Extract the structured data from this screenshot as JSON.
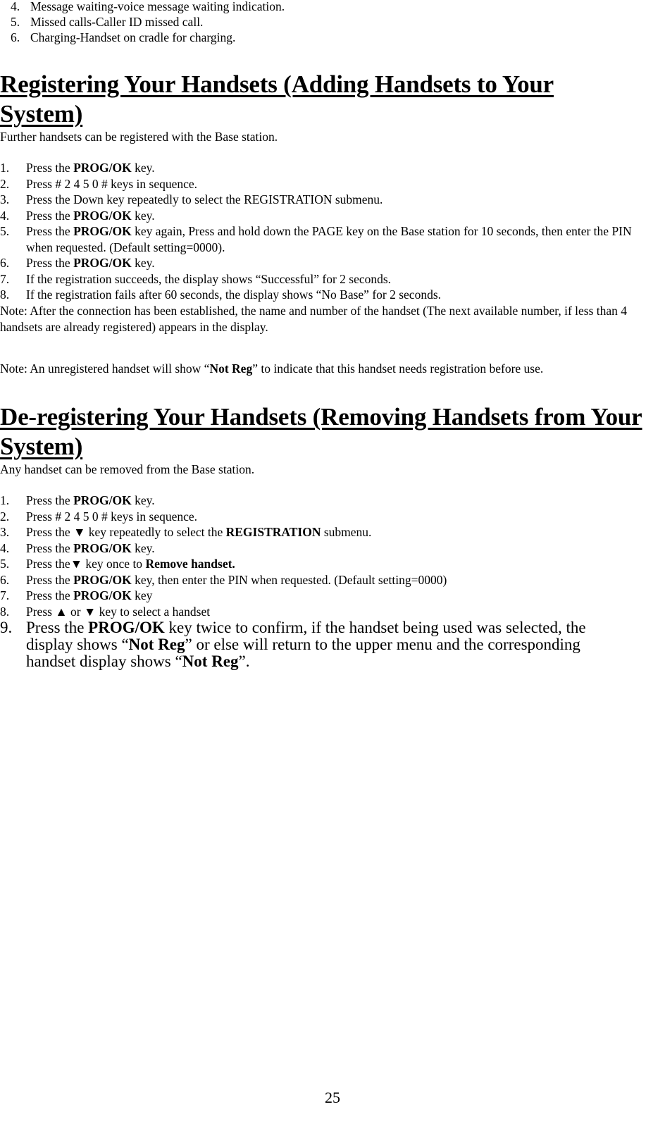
{
  "top_list": [
    {
      "num": "4.",
      "text": "Message waiting-voice message waiting indication."
    },
    {
      "num": "5.",
      "text": "Missed calls-Caller ID missed call."
    },
    {
      "num": "6.",
      "text": "Charging-Handset on cradle for charging."
    }
  ],
  "register": {
    "heading": "Registering Your Handsets (Adding Handsets to Your System)",
    "intro": "Further handsets can be registered with the Base station.",
    "steps": [
      {
        "num": "1.",
        "a": "Press the ",
        "b": "PROG/OK",
        "c": " key."
      },
      {
        "num": "2.",
        "a": "Press # 2 4 5 0 # keys in sequence.",
        "b": "",
        "c": ""
      },
      {
        "num": "3.",
        "a": "Press the Down key repeatedly to select the REGISTRATION submenu.",
        "b": "",
        "c": ""
      },
      {
        "num": "4.",
        "a": "Press the ",
        "b": "PROG/OK",
        "c": " key."
      },
      {
        "num": "5.",
        "a": "Press the ",
        "b": "PROG/OK",
        "c": " key again, Press and hold down the PAGE key on the Base station for 10 seconds, then enter the PIN when requested. (Default setting=0000)."
      },
      {
        "num": "6.",
        "a": "Press the ",
        "b": "PROG/OK",
        "c": " key."
      },
      {
        "num": "7.",
        "a": "If the registration succeeds, the display shows “Successful” for 2 seconds.",
        "b": "",
        "c": ""
      },
      {
        "num": "8.",
        "a": "If the registration fails after 60 seconds, the display shows “No Base” for 2 seconds.",
        "b": "",
        "c": ""
      }
    ],
    "note1": "Note: After the connection has been established, the name and number of the handset (The next available number, if less than 4 handsets are already registered) appears in the display.",
    "note2": {
      "a": "Note: An unregistered handset will show “",
      "b": "Not Reg",
      "c": "” to indicate that this handset needs registration before use."
    }
  },
  "deregister": {
    "heading": "De-registering Your Handsets (Removing Handsets from Your System)",
    "intro": "Any handset can be removed from the Base station.",
    "steps": [
      {
        "num": "1.",
        "a": "Press the ",
        "b": "PROG/OK",
        "c": " key.",
        "d": "",
        "e": ""
      },
      {
        "num": "2.",
        "a": "Press # 2 4 5 0 # keys in sequence.",
        "b": "",
        "c": "",
        "d": "",
        "e": ""
      },
      {
        "num": "3.",
        "a": " Press the ▼ key repeatedly to select the ",
        "b": "REGISTRATION",
        "c": " submenu.",
        "d": "",
        "e": ""
      },
      {
        "num": "4.",
        "a": "Press the ",
        "b": "PROG/OK",
        "c": " key.",
        "d": "",
        "e": ""
      },
      {
        "num": "5.",
        "a": "Press the▼ key once to ",
        "b": "Remove handset.",
        "c": "",
        "d": "",
        "e": ""
      },
      {
        "num": "6.",
        "a": "Press the ",
        "b": "PROG/OK",
        "c": " key, then enter the PIN when requested. (Default setting=0000)",
        "d": "",
        "e": ""
      },
      {
        "num": "7.",
        "a": "Press the ",
        "b": "PROG/OK",
        "c": " key",
        "d": "",
        "e": ""
      },
      {
        "num": "8.",
        "a": "Press ▲ or ▼ key to select a handset",
        "b": "",
        "c": "",
        "d": "",
        "e": ""
      },
      {
        "num": "9.",
        "a": "Press the ",
        "b": "PROG/OK",
        "c": " key twice to confirm, if the handset being used was selected, the display shows “",
        "d": "Not Reg",
        "e": "” or else will return to the upper menu and the corresponding handset display shows “",
        "f": "Not Reg",
        "g": "”."
      }
    ]
  },
  "page_number": "25"
}
